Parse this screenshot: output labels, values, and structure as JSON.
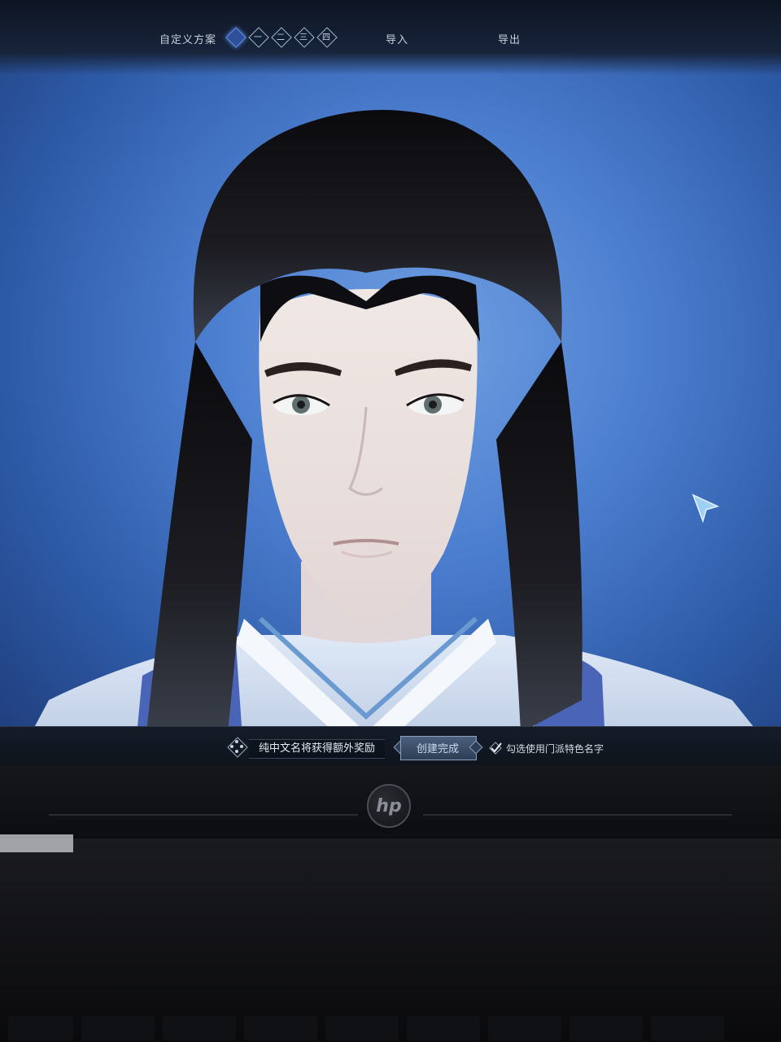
{
  "topbar": {
    "scheme_label": "自定义方案",
    "slots": [
      "",
      "一",
      "二",
      "三",
      "四"
    ],
    "import_label": "导入",
    "export_label": "导出"
  },
  "bottombar": {
    "name_field_value": "纯中文名将获得额外奖励",
    "create_button_label": "创建完成",
    "checkbox_label": "勾选使用门派特色名字",
    "checkbox_checked": true
  },
  "laptop": {
    "brand": "hp"
  },
  "colors": {
    "accent": "#5f8fe8",
    "background_sky": "#4d7fd1"
  }
}
